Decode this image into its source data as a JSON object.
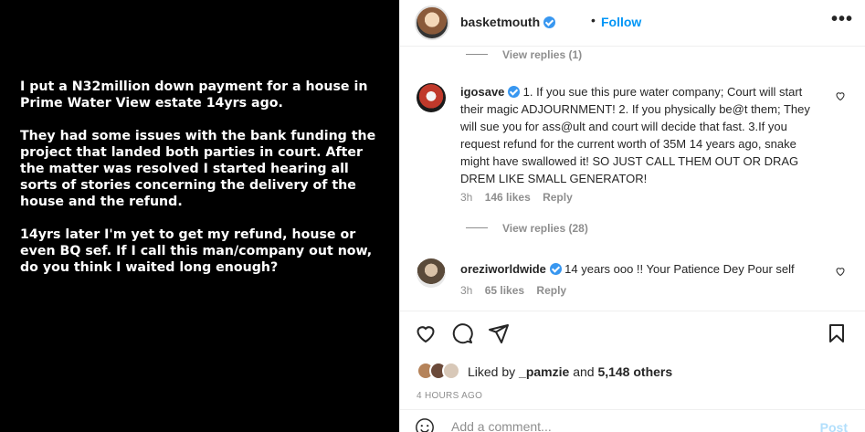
{
  "post": {
    "image_text": [
      "I put a N32million down payment for a house in Prime Water View estate 14yrs ago.",
      "They had some issues with the bank funding the project that landed both parties in court. After the matter was resolved I started hearing all sorts of stories concerning the delivery of the house and the refund.",
      "14yrs later I'm yet to get my refund, house or even BQ sef. If I call this man/company out now, do you think I waited long enough?"
    ]
  },
  "header": {
    "username": "basketmouth",
    "separator": "•",
    "follow_label": "Follow",
    "more_label": "•••"
  },
  "comments": {
    "view_replies_top": "View replies (1)",
    "items": [
      {
        "username": "igosave",
        "text": "1. If you sue this pure water company; Court will start their magic ADJOURNMENT! 2. If you physically be@t them; They will sue you for ass@ult and court will decide that fast. 3.If you request refund for the current worth of 35M 14 years ago, snake might have swallowed it! SO JUST CALL THEM OUT OR DRAG DREM LIKE SMALL GENERATOR!",
        "time": "3h",
        "likes": "146 likes",
        "reply": "Reply",
        "view_replies": "View replies (28)"
      },
      {
        "username": "oreziworldwide",
        "text": "14 years ooo !! Your Patience Dey Pour self",
        "time": "3h",
        "likes": "65 likes",
        "reply": "Reply"
      }
    ]
  },
  "likes": {
    "prefix": "Liked by",
    "user": "_pamzie",
    "middle": "and",
    "others": "5,148 others"
  },
  "timestamp": "4 HOURS AGO",
  "add_comment": {
    "placeholder": "Add a comment...",
    "post_label": "Post"
  },
  "colors": {
    "accent": "#0095f6",
    "verified": "#3897f0",
    "muted": "#8e8e8e",
    "media_bg": "#000000"
  },
  "icons": [
    "verified-badge-icon",
    "more-options-icon",
    "heart-icon",
    "comment-icon",
    "share-icon",
    "bookmark-icon",
    "emoji-icon"
  ]
}
